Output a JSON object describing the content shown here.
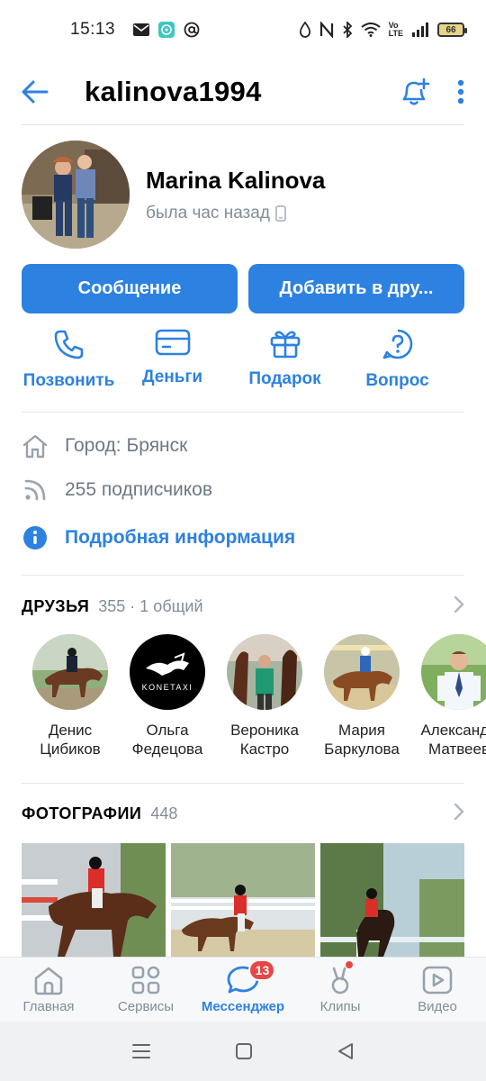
{
  "status_bar": {
    "time": "15:13",
    "battery": "66",
    "network": "Vo LTE"
  },
  "header": {
    "title": "kalinova1994"
  },
  "profile": {
    "name": "Marina Kalinova",
    "status": "была час назад"
  },
  "buttons": {
    "message": "Сообщение",
    "add_friend": "Добавить в дру..."
  },
  "actions": [
    {
      "label": "Позвонить",
      "icon": "phone-icon"
    },
    {
      "label": "Деньги",
      "icon": "card-icon"
    },
    {
      "label": "Подарок",
      "icon": "gift-icon"
    },
    {
      "label": "Вопрос",
      "icon": "question-icon"
    }
  ],
  "info": {
    "city": "Город: Брянск",
    "followers": "255 подписчиков",
    "details_link": "Подробная информация"
  },
  "friends": {
    "title": "ДРУЗЬЯ",
    "count": "355 · 1 общий",
    "items": [
      {
        "first": "Денис",
        "last": "Цибиков"
      },
      {
        "first": "Ольга",
        "last": "Федецова",
        "logo_text": "KONETAXI"
      },
      {
        "first": "Вероника",
        "last": "Кастро"
      },
      {
        "first": "Мария",
        "last": "Баркулова"
      },
      {
        "first": "Александр",
        "last": "Матвеев"
      }
    ]
  },
  "photos": {
    "title": "ФОТОГРАФИИ",
    "count": "448"
  },
  "tabbar": {
    "tabs": [
      {
        "label": "Главная",
        "icon": "home-icon"
      },
      {
        "label": "Сервисы",
        "icon": "services-icon"
      },
      {
        "label": "Мессенджер",
        "icon": "messenger-icon",
        "badge": "13",
        "active": true
      },
      {
        "label": "Клипы",
        "icon": "clips-icon",
        "dot": true
      },
      {
        "label": "Видео",
        "icon": "video-icon"
      }
    ]
  },
  "colors": {
    "accent": "#2d81e0",
    "secondary_text": "#818c99",
    "badge": "#e64646"
  }
}
